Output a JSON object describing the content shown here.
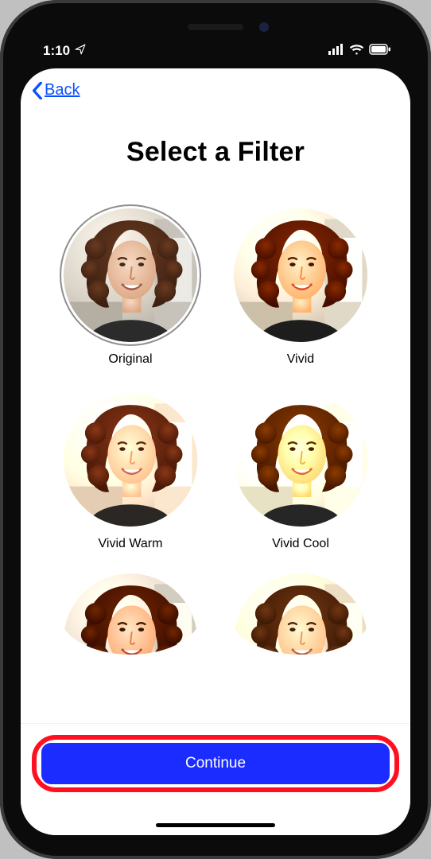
{
  "status": {
    "time": "1:10"
  },
  "nav": {
    "back_label": "Back"
  },
  "page": {
    "title": "Select a Filter"
  },
  "filters": {
    "items": [
      {
        "label": "Original",
        "selected": true,
        "filter_css": "none"
      },
      {
        "label": "Vivid",
        "selected": false,
        "filter_css": "saturate(1.6) contrast(1.18) brightness(1.05)"
      },
      {
        "label": "Vivid Warm",
        "selected": false,
        "filter_css": "saturate(1.6) sepia(.25) hue-rotate(-8deg) brightness(1.08) contrast(1.12)"
      },
      {
        "label": "Vivid Cool",
        "selected": false,
        "filter_css": "saturate(1.55) hue-rotate(12deg) brightness(1.2) contrast(1.18)"
      },
      {
        "label": "",
        "selected": false,
        "filter_css": "saturate(1.3) brightness(.98) contrast(1.22)"
      },
      {
        "label": "",
        "selected": false,
        "filter_css": "saturate(1.35) sepia(.28) brightness(1.02) contrast(1.15)"
      }
    ]
  },
  "cta": {
    "continue_label": "Continue"
  }
}
